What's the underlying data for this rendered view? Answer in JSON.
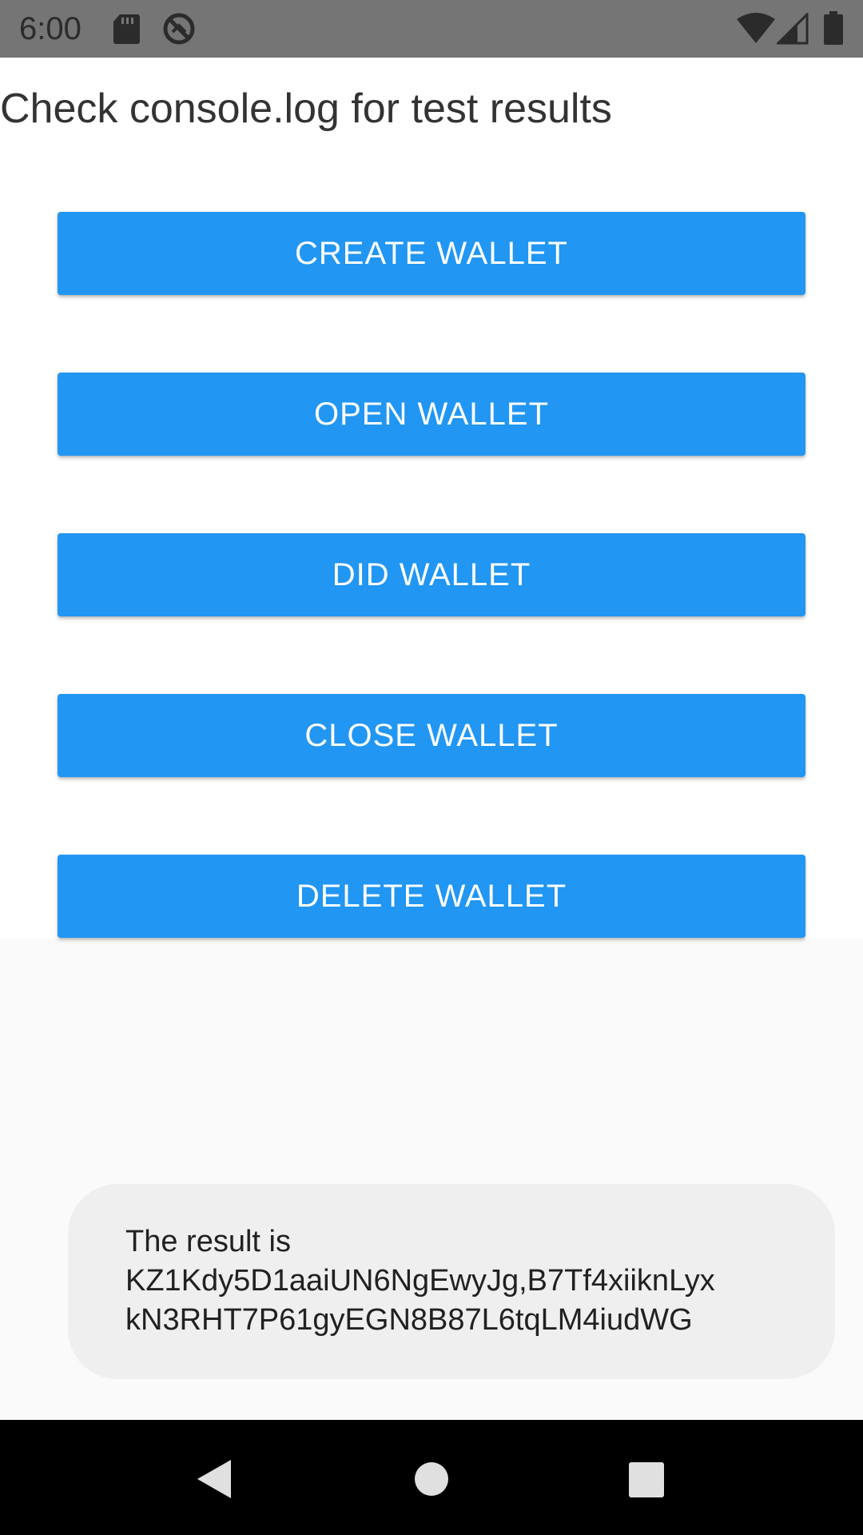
{
  "status_bar": {
    "time": "6:00",
    "icons": [
      "sd-card-icon",
      "sync-blocked-icon",
      "wifi-icon",
      "cell-signal-icon",
      "battery-icon"
    ]
  },
  "main": {
    "instructions": "Check console.log for test results",
    "buttons": [
      {
        "label": "CREATE WALLET"
      },
      {
        "label": "OPEN WALLET"
      },
      {
        "label": "DID WALLET"
      },
      {
        "label": "CLOSE WALLET"
      },
      {
        "label": "DELETE WALLET"
      }
    ]
  },
  "toast": {
    "message": "The result is\nKZ1Kdy5D1aaiUN6NgEwyJg,B7Tf4xiiknLyx\nkN3RHT7P61gyEGN8B87L6tqLM4iudWG"
  },
  "nav_bar": {
    "icons": [
      "back-icon",
      "home-icon",
      "recents-icon"
    ]
  },
  "colors": {
    "button": "#2196f3",
    "button_text": "#ffffff",
    "status_bar": "#757575",
    "nav_bar": "#000000",
    "toast_bg": "#efefef"
  }
}
